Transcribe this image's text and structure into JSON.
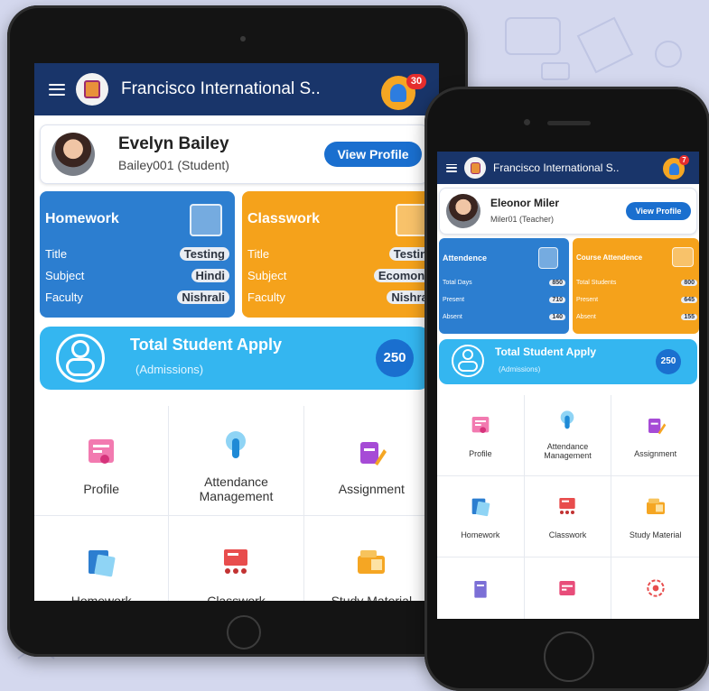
{
  "tablet": {
    "header": {
      "title": "Francisco International S..",
      "notification_count": "30"
    },
    "profile": {
      "name": "Evelyn Bailey",
      "subtitle": "Bailey001 (Student)",
      "button": "View Profile"
    },
    "tiles": [
      {
        "title": "Homework",
        "rows": [
          {
            "label": "Title",
            "value": "Testing"
          },
          {
            "label": "Subject",
            "value": "Hindi"
          },
          {
            "label": "Faculty",
            "value": "Nishrali"
          }
        ]
      },
      {
        "title": "Classwork",
        "rows": [
          {
            "label": "Title",
            "value": "Testing"
          },
          {
            "label": "Subject",
            "value": "Ecomonic"
          },
          {
            "label": "Faculty",
            "value": "Nishrali"
          }
        ]
      }
    ],
    "apply": {
      "title": "Total Student Apply",
      "subtitle": "(Admissions)",
      "count": "250"
    },
    "menu": [
      "Profile",
      "Attendance Management",
      "Assignment",
      "Homework",
      "Classwork",
      "Study Material"
    ]
  },
  "phone": {
    "header": {
      "title": "Francisco International S..",
      "notification_count": "7"
    },
    "profile": {
      "name": "Eleonor Miler",
      "subtitle": "Miler01 (Teacher)",
      "button": "View Profile"
    },
    "tiles": [
      {
        "title": "Attendence",
        "rows": [
          {
            "label": "Total Days",
            "value": "850"
          },
          {
            "label": "Present",
            "value": "710"
          },
          {
            "label": "Absent",
            "value": "140"
          }
        ]
      },
      {
        "title": "Course Attendence",
        "rows": [
          {
            "label": "Total Students",
            "value": "800"
          },
          {
            "label": "Present",
            "value": "645"
          },
          {
            "label": "Absent",
            "value": "155"
          }
        ]
      }
    ],
    "apply": {
      "title": "Total Student Apply",
      "subtitle": "(Admissions)",
      "count": "250"
    },
    "menu": [
      "Profile",
      "Attendance Management",
      "Assignment",
      "Homework",
      "Classwork",
      "Study Material"
    ]
  },
  "colors": {
    "header": "#19356a",
    "blue_tile": "#2c7ed0",
    "orange_tile": "#f5a21b",
    "apply": "#34b6f0",
    "button": "#1a6fcf",
    "badge": "#e52d2d"
  },
  "icons": [
    "menu-icon",
    "school-logo-icon",
    "bell-icon",
    "profile-icon",
    "attendance-icon",
    "assignment-icon",
    "homework-icon",
    "classwork-icon",
    "study-material-icon"
  ]
}
